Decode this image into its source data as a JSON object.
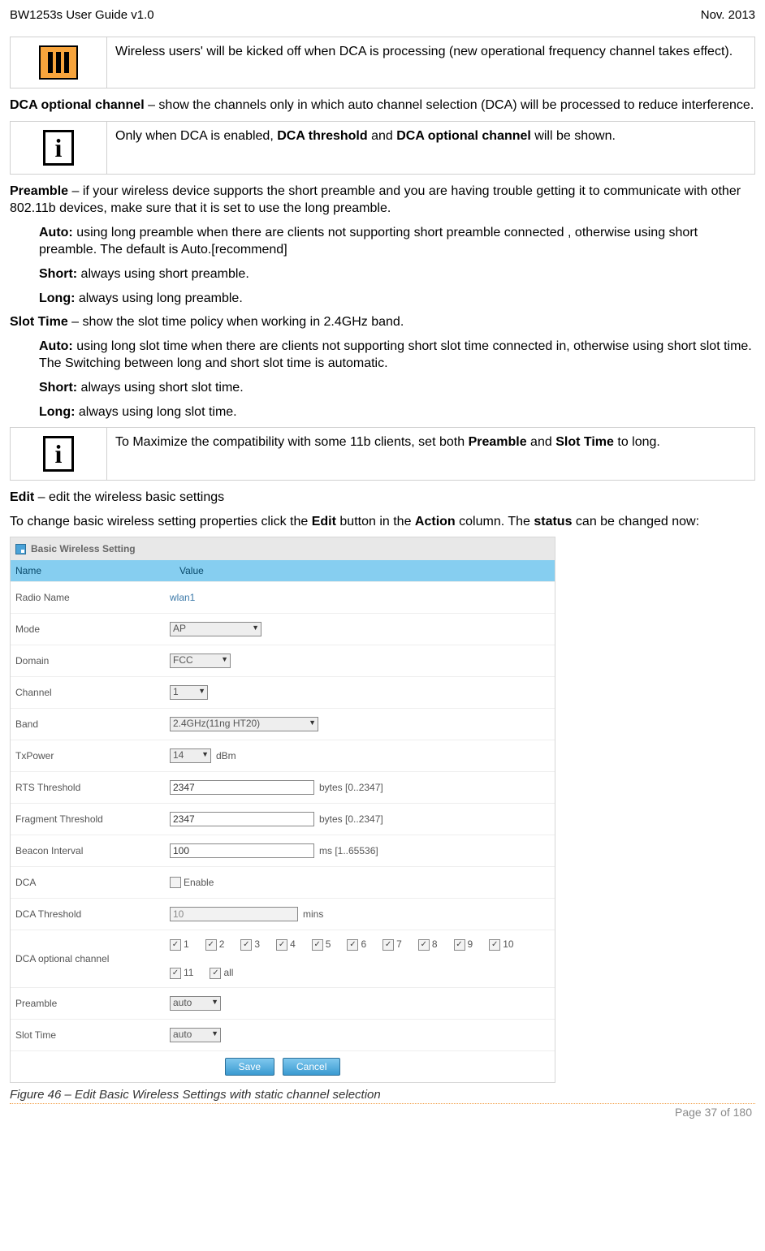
{
  "header": {
    "left": "BW1253s User Guide v1.0",
    "right": "Nov.  2013"
  },
  "callout1": "Wireless users' will be kicked off when DCA is processing (new operational frequency channel takes effect).",
  "p_dca_opt_1": "DCA optional channel",
  "p_dca_opt_2": " – show the channels only in which auto channel selection (DCA) will be processed to reduce interference.",
  "callout2_a": "Only when DCA is enabled, ",
  "callout2_b": "DCA threshold",
  "callout2_c": " and ",
  "callout2_d": "DCA optional channel",
  "callout2_e": " will be shown.",
  "p_preamble_1": "Preamble",
  "p_preamble_2": " – if your wireless device supports the short preamble and you are having trouble getting it to communicate with other 802.11b devices, make sure that it is set to use the long preamble.",
  "pre_auto_1": "Auto:",
  "pre_auto_2": " using long preamble when there are clients not supporting short preamble connected , otherwise using short preamble. The default is Auto.[recommend]",
  "pre_short_1": "Short:",
  "pre_short_2": " always using short preamble.",
  "pre_long_1": "Long:",
  "pre_long_2": " always using long preamble.",
  "p_slot_1": "Slot Time",
  "p_slot_2": " – show the slot time policy when working in 2.4GHz band.",
  "slot_auto_1": "Auto:",
  "slot_auto_2": " using long slot time when there are clients not supporting short slot time connected in, otherwise using short slot time. The Switching between long and short slot time is automatic.",
  "slot_short_1": "Short:",
  "slot_short_2": " always using short slot time.",
  "slot_long_1": "Long:",
  "slot_long_2": " always using long slot time.",
  "callout3_a": "To Maximize the compatibility with some 11b clients, set both ",
  "callout3_b": "Preamble",
  "callout3_c": " and ",
  "callout3_d": "Slot Time",
  "callout3_e": " to long.",
  "p_edit_1": "Edit",
  "p_edit_2": " – edit the wireless basic settings",
  "p_change_a": "To change basic wireless setting properties click the ",
  "p_change_b": "Edit",
  "p_change_c": " button in the ",
  "p_change_d": "Action",
  "p_change_e": " column. The ",
  "p_change_f": "status",
  "p_change_g": " can be changed now:",
  "shot": {
    "title": "Basic Wireless Setting",
    "head_name": "Name",
    "head_value": "Value",
    "rows": {
      "radio_name": {
        "lab": "Radio Name",
        "val": "wlan1"
      },
      "mode": {
        "lab": "Mode",
        "val": "AP"
      },
      "domain": {
        "lab": "Domain",
        "val": "FCC"
      },
      "channel": {
        "lab": "Channel",
        "val": "1"
      },
      "band": {
        "lab": "Band",
        "val": "2.4GHz(11ng HT20)"
      },
      "txpower": {
        "lab": "TxPower",
        "val": "14",
        "unit": "dBm"
      },
      "rts": {
        "lab": "RTS Threshold",
        "val": "2347",
        "hint": "bytes [0..2347]"
      },
      "frag": {
        "lab": "Fragment Threshold",
        "val": "2347",
        "hint": "bytes [0..2347]"
      },
      "beacon": {
        "lab": "Beacon Interval",
        "val": "100",
        "hint": "ms [1..65536]"
      },
      "dca": {
        "lab": "DCA",
        "val": "Enable"
      },
      "dca_th": {
        "lab": "DCA Threshold",
        "val": "10",
        "hint": "mins"
      },
      "dca_opt": {
        "lab": "DCA optional channel",
        "opts": [
          "1",
          "2",
          "3",
          "4",
          "5",
          "6",
          "7",
          "8",
          "9",
          "10",
          "11",
          "all"
        ]
      },
      "preamble": {
        "lab": "Preamble",
        "val": "auto"
      },
      "slottime": {
        "lab": "Slot Time",
        "val": "auto"
      }
    },
    "save": "Save",
    "cancel": "Cancel"
  },
  "caption": "Figure 46 – Edit Basic Wireless Settings with static channel selection",
  "footer": "Page 37 of 180"
}
